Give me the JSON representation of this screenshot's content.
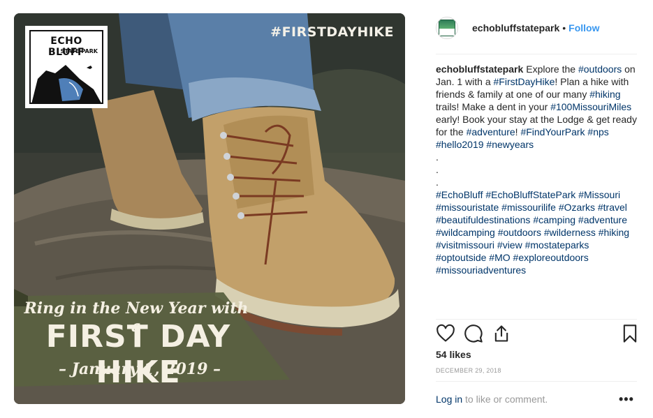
{
  "photo": {
    "overlay_hashtag": "#FIRSTDAYHIKE",
    "logo_title": "ECHO BLUFF",
    "logo_subtitle": "STATE PARK",
    "banner_line1": "Ring in the New Year with a",
    "banner_line2": "FIRST DAY HIKE",
    "banner_line3": "– January 1, 2019 –"
  },
  "header": {
    "username": "echobluffstatepark",
    "separator": "•",
    "follow_label": "Follow"
  },
  "caption": {
    "username": "echobluffstatepark",
    "parts": [
      {
        "t": "Explore the "
      },
      {
        "t": "#outdoors",
        "tag": true
      },
      {
        "t": " on Jan. 1 with a "
      },
      {
        "t": "#FirstDayHike",
        "tag": true
      },
      {
        "t": "! Plan a hike with friends & family at one of our many "
      },
      {
        "t": "#hiking",
        "tag": true
      },
      {
        "t": " trails! Make a dent in your "
      },
      {
        "t": "#100MissouriMiles",
        "tag": true
      },
      {
        "t": " early! Book your stay at the Lodge & get ready for the "
      },
      {
        "t": "#adventure",
        "tag": true
      },
      {
        "t": "! "
      },
      {
        "t": "#FindYourPark",
        "tag": true
      },
      {
        "t": " "
      },
      {
        "t": "#nps",
        "tag": true
      },
      {
        "t": " "
      },
      {
        "t": "#hello2019",
        "tag": true
      },
      {
        "t": " "
      },
      {
        "t": "#newyears",
        "tag": true
      }
    ],
    "dots": [
      ".",
      ".",
      "."
    ],
    "hashtags": [
      "#EchoBluff",
      "#EchoBluffStatePark",
      "#Missouri",
      "#missouristate",
      "#missourilife",
      "#Ozarks",
      "#travel",
      "#beautifuldestinations",
      "#camping",
      "#adventure",
      "#wildcamping",
      "#outdoors",
      "#wilderness",
      "#hiking",
      "#visitmissouri",
      "#view",
      "#mostateparks",
      "#optoutside",
      "#MO",
      "#exploreoutdoors",
      "#missouriadventures"
    ]
  },
  "actions": {
    "like_icon": "heart-icon",
    "comment_icon": "comment-icon",
    "share_icon": "share-icon",
    "save_icon": "bookmark-icon"
  },
  "likes_text": "54 likes",
  "date_text": "DECEMBER 29, 2018",
  "login": {
    "link_label": "Log in",
    "rest": " to like or comment."
  },
  "more_label": "•••"
}
